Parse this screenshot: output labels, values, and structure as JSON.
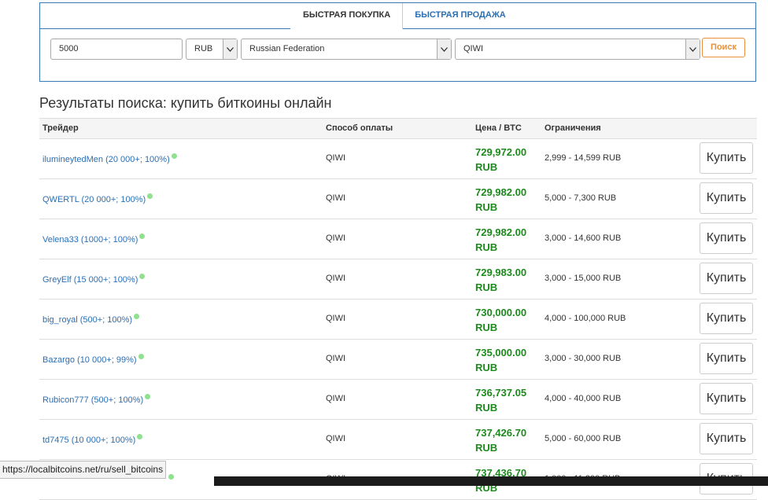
{
  "tabs": [
    {
      "label": "БЫСТРАЯ ПОКУПКА",
      "active": true
    },
    {
      "label": "БЫСТРАЯ ПРОДАЖА",
      "active": false
    }
  ],
  "search": {
    "amount": "5000",
    "currency": "RUB",
    "country": "Russian Federation",
    "payment_method": "QIWI",
    "button_label": "Поиск"
  },
  "results_title": "Результаты поиска: купить биткоины онлайн",
  "columns": {
    "trader": "Трейдер",
    "method": "Способ оплаты",
    "price": "Цена / BTC",
    "limits": "Ограничения"
  },
  "rows": [
    {
      "trader": "ilumineytedMen (20 000+; 100%)",
      "method": "QIWI",
      "price": "729,972.00",
      "currency": "RUB",
      "limits": "2,999 - 14,599 RUB",
      "button": "Купить"
    },
    {
      "trader": "QWERTL (20 000+; 100%)",
      "method": "QIWI",
      "price": "729,982.00",
      "currency": "RUB",
      "limits": "5,000 - 7,300 RUB",
      "button": "Купить"
    },
    {
      "trader": "Velena33 (1000+; 100%)",
      "method": "QIWI",
      "price": "729,982.00",
      "currency": "RUB",
      "limits": "3,000 - 14,600 RUB",
      "button": "Купить"
    },
    {
      "trader": "GreyElf (15 000+; 100%)",
      "method": "QIWI",
      "price": "729,983.00",
      "currency": "RUB",
      "limits": "3,000 - 15,000 RUB",
      "button": "Купить"
    },
    {
      "trader": "big_royal (500+; 100%)",
      "method": "QIWI",
      "price": "730,000.00",
      "currency": "RUB",
      "limits": "4,000 - 100,000 RUB",
      "button": "Купить"
    },
    {
      "trader": "Bazargo (10 000+; 99%)",
      "method": "QIWI",
      "price": "735,000.00",
      "currency": "RUB",
      "limits": "3,000 - 30,000 RUB",
      "button": "Купить"
    },
    {
      "trader": "Rubicon777 (500+; 100%)",
      "method": "QIWI",
      "price": "736,737.05",
      "currency": "RUB",
      "limits": "4,000 - 40,000 RUB",
      "button": "Купить"
    },
    {
      "trader": "td7475 (10 000+; 100%)",
      "method": "QIWI",
      "price": "737,426.70",
      "currency": "RUB",
      "limits": "5,000 - 60,000 RUB",
      "button": "Купить"
    },
    {
      "trader": "",
      "method": "QIWI",
      "price": "737,436.70",
      "currency": "RUB",
      "limits": "1,000 - 11,200 RUB",
      "button": "Купить"
    }
  ],
  "status_url": "https://localbitcoins.net/ru/sell_bitcoins",
  "colors": {
    "link": "#2a6fb5",
    "price": "#1c8a1c",
    "search_button": "#e8913a",
    "online_dot": "#8fe08f"
  }
}
